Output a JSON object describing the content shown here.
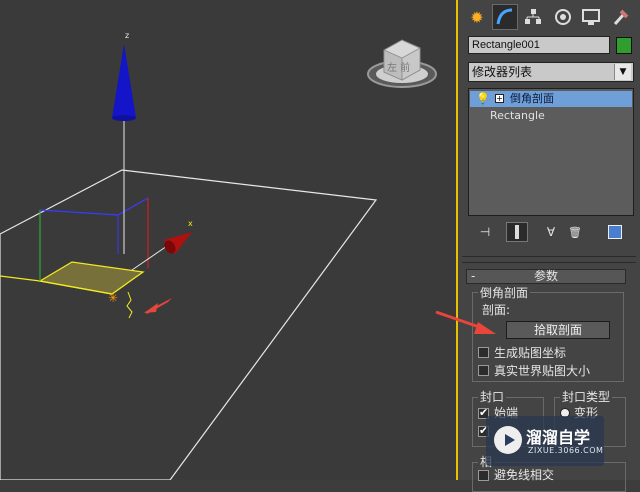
{
  "viewport": {
    "axis_label_z": "z",
    "axis_label_x": "x",
    "viewcube_label": "左 前"
  },
  "panel": {
    "tabs": [
      "create-icon",
      "modify-icon",
      "hierarchy-icon",
      "motion-icon",
      "display-icon",
      "utilities-icon"
    ],
    "object_name": "Rectangle001",
    "object_color": "#2f9e2f",
    "modifier_list": "修改器列表",
    "stack": [
      {
        "label": "倒角剖面",
        "selected": true
      },
      {
        "label": "Rectangle",
        "selected": false
      }
    ],
    "rollout": {
      "title": "参数",
      "collapse": "-",
      "bevel_group": "倒角剖面",
      "profile_label": "剖面:",
      "pick_button": "拾取剖面",
      "gen_map_coords": "生成贴图坐标",
      "real_world_map": "真实世界贴图大小",
      "cap_group": "封口",
      "cap_start": "始端",
      "cap_type_group": "封口类型",
      "cap_type_morph": "变形",
      "bottom_group_fragment": "相",
      "avoid_intersect": "避免线相交"
    }
  },
  "watermark": {
    "brand": "溜溜自学",
    "url": "ZIXUE.3066.COM"
  },
  "colors": {
    "selection_blue": "#6f9fd8",
    "viewport_border": "#e8c000",
    "annotation_arrow": "#e8463a"
  }
}
